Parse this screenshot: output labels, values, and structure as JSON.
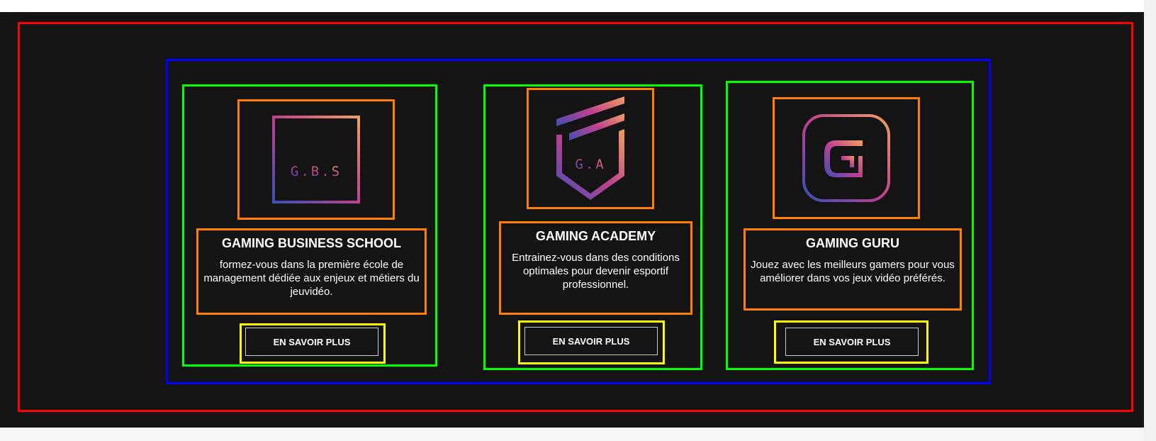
{
  "cards": [
    {
      "logo_text": "G.B.S",
      "title": "GAMING BUSINESS SCHOOL",
      "description": "formez-vous dans la première école de management dédiée aux enjeux et métiers du jeuvidéo.",
      "button": "EN SAVOIR PLUS"
    },
    {
      "logo_text": "G.A",
      "title": "GAMING ACADEMY",
      "description": "Entrainez-vous dans des conditions optimales pour devenir esportif professionnel.",
      "button": "EN SAVOIR PLUS"
    },
    {
      "logo_text": "G",
      "title": "GAMING GURU",
      "description": "Jouez avec les meilleurs gamers pour vous améliorer dans vos jeux vidéo préférés.",
      "button": "EN SAVOIR PLUS"
    }
  ],
  "colors": {
    "background": "#141414",
    "gradient_start": "#3b4fb8",
    "gradient_mid": "#c0408f",
    "gradient_end": "#f0a060"
  }
}
